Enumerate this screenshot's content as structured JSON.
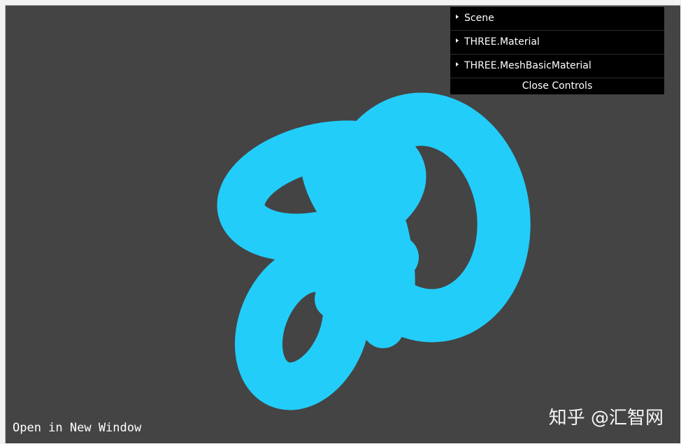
{
  "scene": {
    "background": "#444444",
    "mesh_color": "#22cdfa",
    "mesh_name": "torus-knot"
  },
  "gui": {
    "folders": [
      {
        "label": "Scene"
      },
      {
        "label": "THREE.Material"
      },
      {
        "label": "THREE.MeshBasicMaterial"
      }
    ],
    "close_label": "Close Controls"
  },
  "footer": {
    "open_link": "Open in New Window"
  },
  "watermark": {
    "text": "知乎 @汇智网"
  }
}
